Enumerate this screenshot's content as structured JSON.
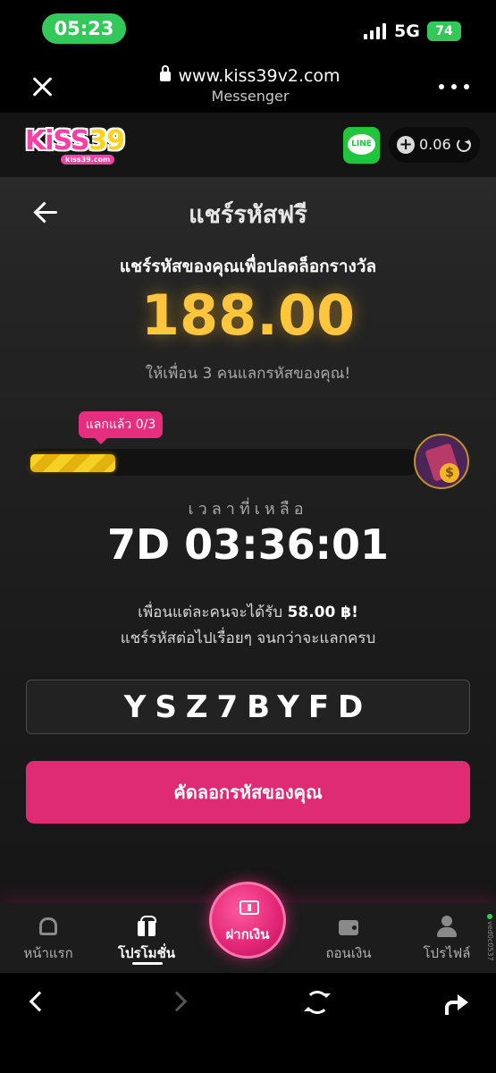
{
  "status_bar": {
    "time": "05:23",
    "network": "5G",
    "battery": "74"
  },
  "browser": {
    "url": "www.kiss39v2.com",
    "app_name": "Messenger"
  },
  "site_header": {
    "logo_text_main": "KiSS",
    "logo_text_num": "39",
    "logo_sub": "kiss39.com",
    "line_label": "LINE",
    "balance": "0.06"
  },
  "promo": {
    "title": "แชร์รหัสฟรี",
    "subtitle": "แชร์รหัสของคุณเพื่อปลดล็อกรางวัล",
    "amount": "188.00",
    "invite_note": "ให้เพื่อน 3 คนแลกรหัสของคุณ!",
    "redeem_badge": "แลกแล้ว 0/3",
    "progress_fraction": 0.22,
    "time_label": "เวลาที่เหลือ",
    "countdown": "7D 03:36:01",
    "reward_prefix": "เพื่อนแต่ละคนจะได้รับ ",
    "reward_amount": "58.00 ฿!",
    "share_note": "แชร์รหัสต่อไปเรื่อยๆ จนกว่าจะแลกครบ",
    "code": "YSZ7BYFD",
    "copy_button": "คัดลอกรหัสของคุณ"
  },
  "bottom_nav": {
    "items": [
      {
        "label": "หน้าแรก",
        "icon": "home-icon"
      },
      {
        "label": "โปรโมชั่น",
        "icon": "gift-icon"
      },
      {
        "label": "ถอนเงิน",
        "icon": "wallet-icon"
      },
      {
        "label": "โปรไฟล์",
        "icon": "user-icon"
      }
    ],
    "deposit_label": "ฝากเงิน",
    "version": "ved0c0537"
  },
  "colors": {
    "accent_pink": "#df2b73",
    "amount_gold": "#ffc53d",
    "status_green": "#32c85a"
  }
}
